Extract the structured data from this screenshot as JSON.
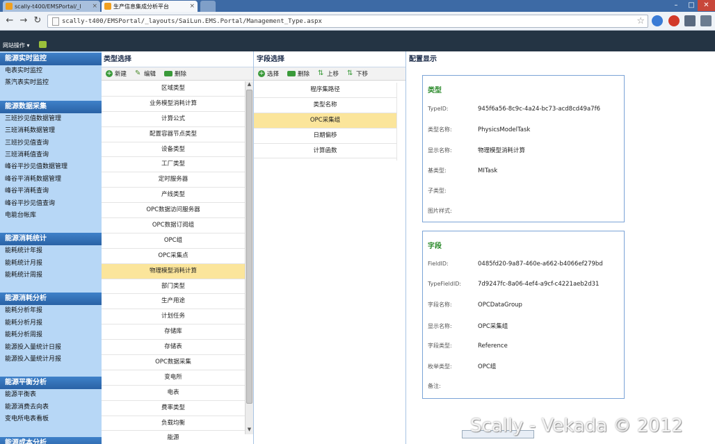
{
  "browser": {
    "tabs": [
      {
        "title": "scally-t400/EMSPortal/_l"
      },
      {
        "title": "生产信息集成分析平台"
      }
    ],
    "url": "scally-t400/EMSPortal/_layouts/SaiLun.EMS.Portal/Management_Type.aspx"
  },
  "ribbon": {
    "site_actions": "网站操作 ▾"
  },
  "leftnav": [
    {
      "header": "能源实时监控",
      "items": [
        "电表实时监控",
        "蒸汽表实时监控"
      ]
    },
    {
      "header": "能源数据采集",
      "items": [
        "三班抄见值数据管理",
        "三班消耗数据管理",
        "三班抄见值查询",
        "三班消耗值查询",
        "峰谷平抄见值数据管理",
        "峰谷平消耗数据管理",
        "峰谷平消耗查询",
        "峰谷平抄见值查询",
        "电能台帐库"
      ]
    },
    {
      "header": "能源消耗统计",
      "items": [
        "能耗统计年报",
        "能耗统计月报",
        "能耗统计周报"
      ]
    },
    {
      "header": "能源消耗分析",
      "items": [
        "能耗分析年报",
        "能耗分析月报",
        "能耗分析周报",
        "能源投入量统计日报",
        "能源投入量统计月报"
      ]
    },
    {
      "header": "能源平衡分析",
      "items": [
        "能源平衡表",
        "能源消费去向表",
        "变电所电表看板"
      ]
    },
    {
      "header": "能源成本分析",
      "items": []
    }
  ],
  "type_panel": {
    "title": "类型选择",
    "toolbar": {
      "new": "新建",
      "edit": "编辑",
      "delete": "删除"
    },
    "rows": [
      "区域类型",
      "业务模型消耗计算",
      "计算公式",
      "配置容器节点类型",
      "设备类型",
      "工厂类型",
      "定时服务器",
      "产线类型",
      "OPC数据访问服务器",
      "OPC数据订阅组",
      "OPC组",
      "OPC采集点",
      "物理模型消耗计算",
      "部门类型",
      "生产用途",
      "计划任务",
      "存储库",
      "存储表",
      "OPC数据采集",
      "变电所",
      "电表",
      "费率类型",
      "负载均衡",
      "能源"
    ],
    "selected_index": 12
  },
  "field_panel": {
    "title": "字段选择",
    "toolbar": {
      "select": "选择",
      "delete": "删除",
      "up": "上移",
      "down": "下移"
    },
    "rows": [
      "程序集路径",
      "类型名称",
      "OPC采集组",
      "日期偏移",
      "计算函数"
    ],
    "selected_index": 2
  },
  "config_panel": {
    "title": "配置显示",
    "type_box": {
      "heading": "类型",
      "rows": [
        {
          "key": "TypeID:",
          "value": "945f6a56-8c9c-4a24-bc73-acd8cd49a7f6"
        },
        {
          "key": "类型名称:",
          "value": "PhysicsModelTask"
        },
        {
          "key": "显示名称:",
          "value": "物理模型消耗计算"
        },
        {
          "key": "基类型:",
          "value": "MITask"
        },
        {
          "key": "子类型:",
          "value": ""
        },
        {
          "key": "图片样式:",
          "value": ""
        }
      ]
    },
    "field_box": {
      "heading": "字段",
      "rows": [
        {
          "key": "FieldID:",
          "value": "0485fd20-9a87-460e-a662-b4066ef279bd"
        },
        {
          "key": "TypeFieldID:",
          "value": "7d9247fc-8a06-4ef4-a9cf-c4221aeb2d31"
        },
        {
          "key": "字段名称:",
          "value": "OPCDataGroup"
        },
        {
          "key": "显示名称:",
          "value": "OPC采集组"
        },
        {
          "key": "字段类型:",
          "value": "Reference"
        },
        {
          "key": "枚举类型:",
          "value": "OPC组"
        },
        {
          "key": "备注:",
          "value": ""
        }
      ]
    }
  },
  "watermark": "Scally - Vekada © 2012",
  "colors": {
    "nav_bg": "#b7d7f6",
    "nav_header": "#2f6db4",
    "selected_row": "#fbe59b",
    "box_heading": "#2b8a2b",
    "ribbon": "#243444"
  }
}
